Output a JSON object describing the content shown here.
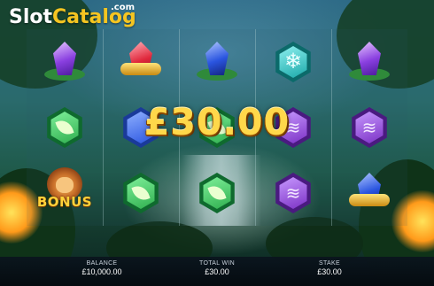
{
  "logo": {
    "part1": "Slot",
    "part2": "Catalog",
    "suffix": ".com"
  },
  "win_amount": "£30.00",
  "reels": [
    [
      "crystal-purple",
      "hex-green-leaf",
      "bonus-lion"
    ],
    [
      "crystal-red-gold",
      "hex-blue",
      "hex-green-leaf"
    ],
    [
      "crystal-blue",
      "hex-green-leaf",
      "hex-green-leaf"
    ],
    [
      "hex-teal-snowflake",
      "hex-purple-swirl",
      "hex-purple-swirl"
    ],
    [
      "crystal-purple",
      "hex-purple-swirl",
      "crystal-blue-gold"
    ]
  ],
  "bonus_label": "BONUS",
  "footer": {
    "balance_label": "BALANCE",
    "balance_value": "£10,000.00",
    "total_win_label": "TOTAL WIN",
    "total_win_value": "£30.00",
    "stake_label": "STAKE",
    "stake_value": "£30.00"
  },
  "colors": {
    "gold_text": "#ffd84a",
    "logo_accent": "#f5c521",
    "gem_green": "#2fae4e",
    "gem_purple": "#7a2fc4",
    "gem_teal": "#1aa8a8",
    "gem_red": "#e0283c",
    "gem_blue": "#2a55e0"
  }
}
